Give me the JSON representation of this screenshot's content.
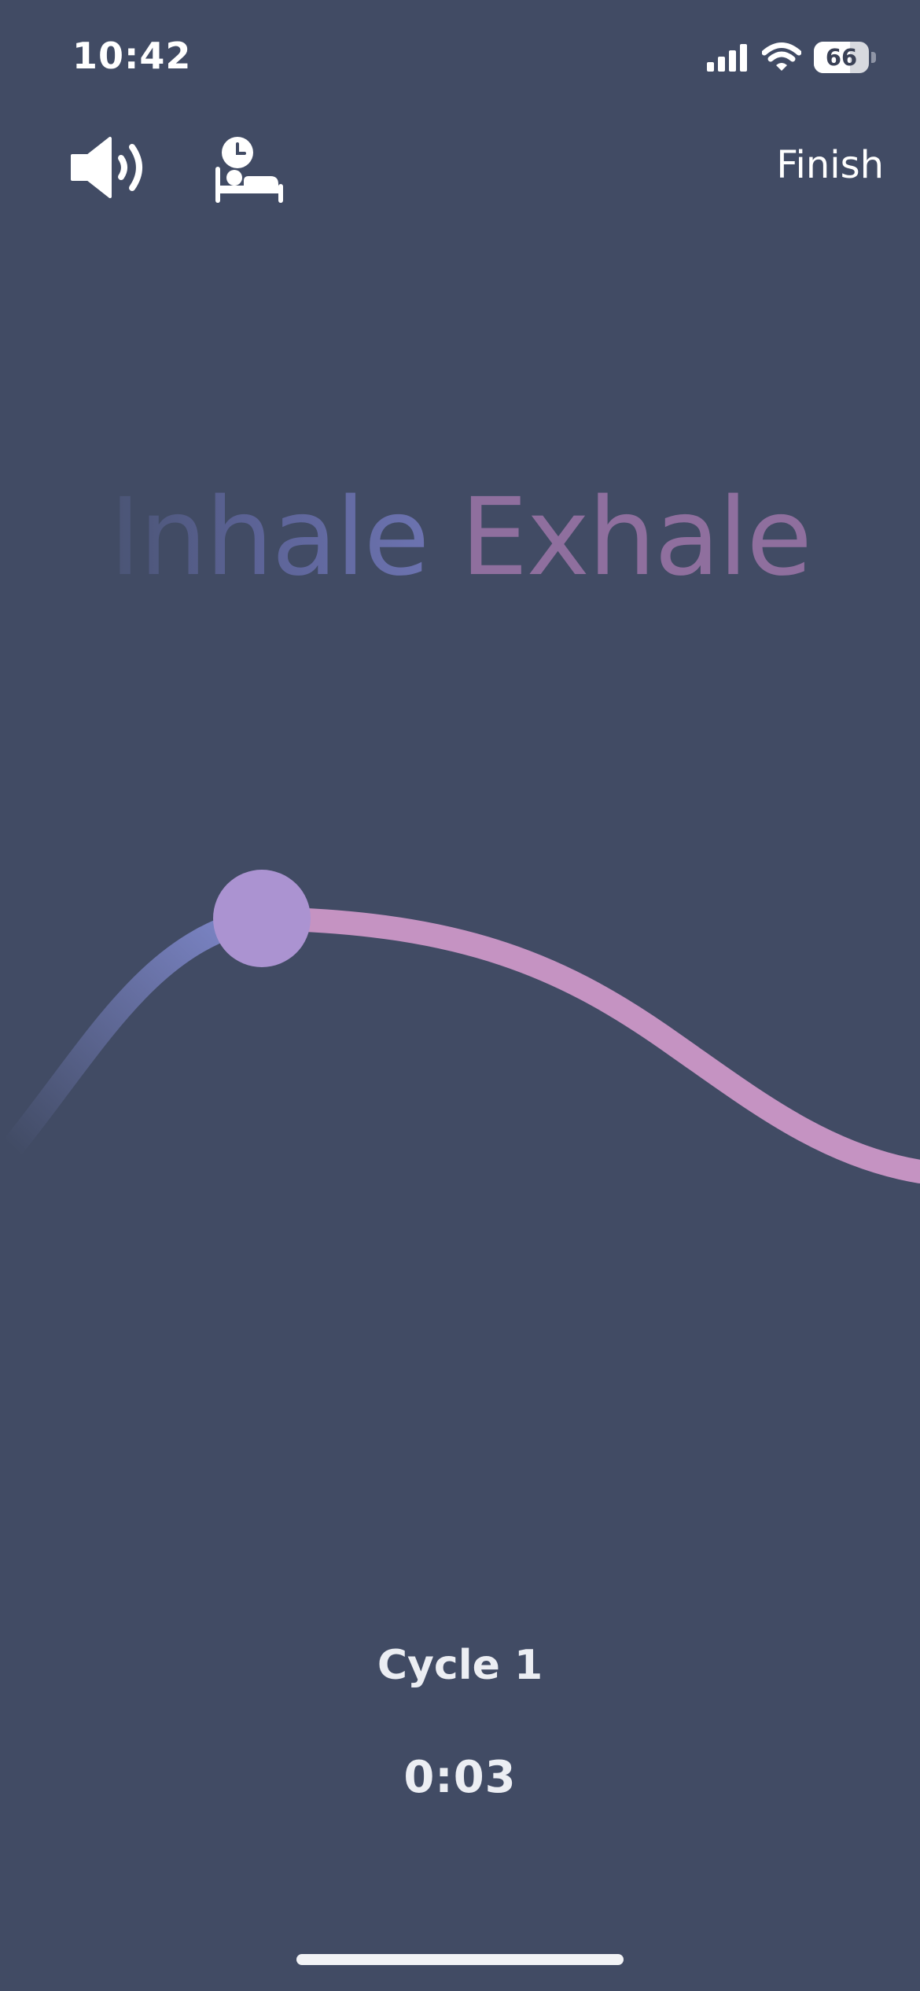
{
  "status_bar": {
    "time": "10:42",
    "battery": "66",
    "battery_level": 0.66,
    "icons": [
      "signal-icon",
      "wifi-icon",
      "battery-icon"
    ]
  },
  "controls": {
    "sound_icon": "speaker-volume-icon",
    "sleep_icon": "sleep-timer-icon",
    "finish_label": "Finish"
  },
  "exercise": {
    "inhale_label": "Inhale",
    "exhale_label": "Exhale",
    "cycle_label": "Cycle 1",
    "elapsed": "0:03"
  },
  "colors": {
    "background": "#414b64",
    "inhale": "#7d86c8",
    "exhale": "#c593c2",
    "marker": "#ab93d1",
    "text": "#ffffff"
  }
}
